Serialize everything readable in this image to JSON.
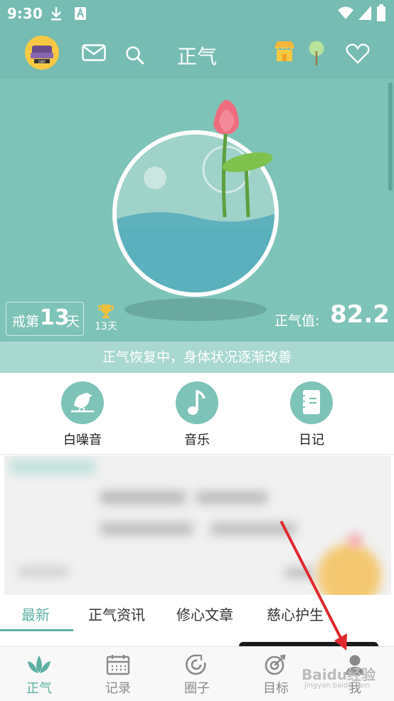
{
  "status_bar": {
    "time": "9:30"
  },
  "header": {
    "title": "正气"
  },
  "hero": {
    "abstain_prefix": "戒第",
    "abstain_days": "13",
    "abstain_suffix": "天",
    "trophy_days": "13天",
    "score_label": "正气值:",
    "score_value": "82.2"
  },
  "banner": {
    "text": "正气恢复中，身体状况逐渐改善"
  },
  "quick_actions": [
    {
      "label": "白噪音"
    },
    {
      "label": "音乐"
    },
    {
      "label": "日记"
    }
  ],
  "tabs": [
    {
      "label": "最新",
      "active": true
    },
    {
      "label": "正气资讯"
    },
    {
      "label": "修心文章"
    },
    {
      "label": "慈心护生"
    }
  ],
  "nav": [
    {
      "label": "正气",
      "active": true
    },
    {
      "label": "记录"
    },
    {
      "label": "圈子"
    },
    {
      "label": "目标"
    },
    {
      "label": "我"
    }
  ],
  "watermark": {
    "text": "Baidu经验",
    "sub": "jingyan.baidu.com"
  },
  "colors": {
    "primary": "#76bcb2",
    "hero": "#7ec3b7",
    "banner": "#a8d8d0",
    "arrow": "#e0282e"
  }
}
